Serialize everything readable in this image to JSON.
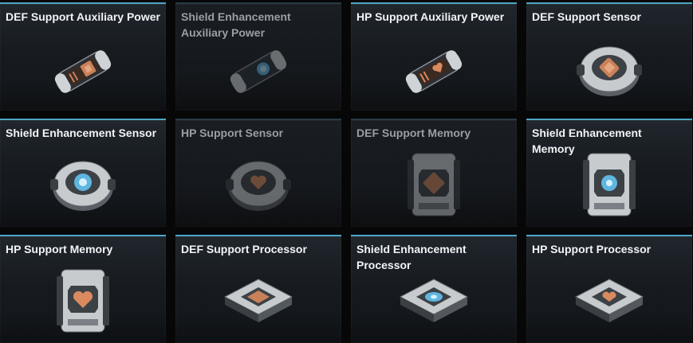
{
  "items": [
    {
      "name": "DEF Support Auxiliary Power",
      "icon": "cylinder-def-icon",
      "enabled": true
    },
    {
      "name": "Shield Enhancement Auxiliary Power",
      "icon": "cylinder-shield-icon",
      "enabled": false
    },
    {
      "name": "HP Support Auxiliary Power",
      "icon": "cylinder-hp-icon",
      "enabled": true
    },
    {
      "name": "DEF Support Sensor",
      "icon": "sensor-def-icon",
      "enabled": true
    },
    {
      "name": "Shield Enhancement Sensor",
      "icon": "sensor-shield-icon",
      "enabled": true
    },
    {
      "name": "HP Support Sensor",
      "icon": "sensor-hp-icon",
      "enabled": false
    },
    {
      "name": "DEF Support Memory",
      "icon": "memory-def-icon",
      "enabled": false
    },
    {
      "name": "Shield Enhancement Memory",
      "icon": "memory-shield-icon",
      "enabled": true
    },
    {
      "name": "HP Support Memory",
      "icon": "memory-hp-icon",
      "enabled": true
    },
    {
      "name": "DEF Support Processor",
      "icon": "processor-def-icon",
      "enabled": true
    },
    {
      "name": "Shield Enhancement Processor",
      "icon": "processor-shield-icon",
      "enabled": true
    },
    {
      "name": "HP Support Processor",
      "icon": "processor-hp-icon",
      "enabled": true
    }
  ],
  "colors": {
    "accent": "#4ea6c4",
    "def_core": "#c9815a",
    "shield_core": "#5fb6e0",
    "hp_core": "#d98a5e"
  }
}
